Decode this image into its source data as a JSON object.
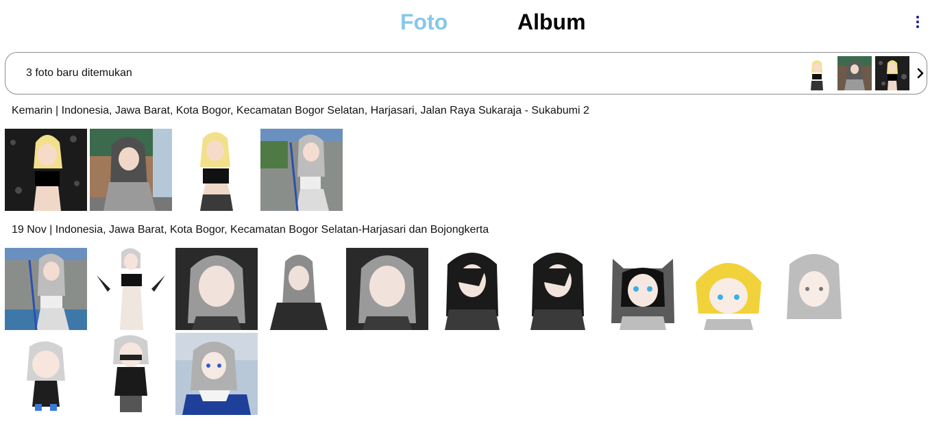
{
  "header": {
    "tab_foto": "Foto",
    "tab_album": "Album",
    "active_tab_color": "#87c8e8",
    "menu_icon": "more-vertical-icon"
  },
  "banner": {
    "text": "3 foto baru ditemukan",
    "chevron_icon": "chevron-right-icon"
  },
  "sections": [
    {
      "title": "Kemarin | Indonesia, Jawa Barat, Kota Bogor, Kecamatan Bogor Selatan, Harjasari, Jalan Raya Sukaraja - Sukabumi 2",
      "photo_count": 4
    },
    {
      "title": "19 Nov | Indonesia, Jawa Barat, Kota Bogor, Kecamatan Bogor Selatan-Harjasari dan Bojongkerta",
      "photo_count": 13
    }
  ]
}
